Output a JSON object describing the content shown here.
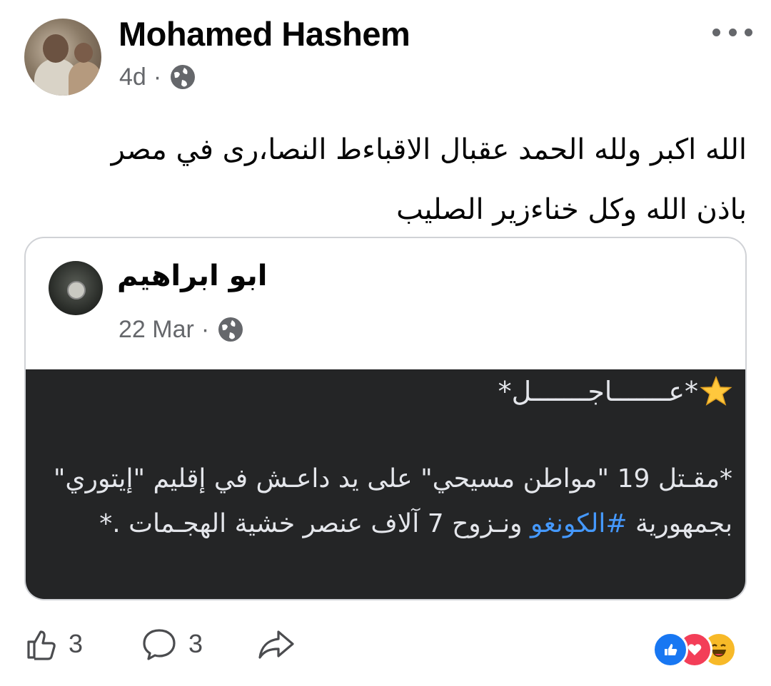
{
  "post": {
    "author": "Mohamed Hashem",
    "time": "4d",
    "separator": "·",
    "text": "الله اكبر ولله الحمد عقبال الاقباءط النصا،رى في مصر باذن الله وكل خناءزير الصليب"
  },
  "shared_post": {
    "author": "ابو ابراهيم",
    "time": "22 Mar",
    "separator": "·",
    "headline": "*عـــــــاجـــــــل*",
    "body_part1": "*مقـتل 19 \"مواطن مسيحي\" على يد داعـش في إقليم \"إيتوري\" بجمهورية",
    "hashtag": "#الكونغو",
    "body_part2": "ونـزوح 7 آلاف عنصر خشية الهجـمات .*"
  },
  "footer": {
    "like_count": "3",
    "comment_count": "3"
  },
  "icons": {
    "privacy": "globe-icon",
    "menu": "more-icon",
    "star": "star-icon",
    "like": "like-icon",
    "comment": "comment-icon",
    "share": "share-icon"
  },
  "colors": {
    "hashtag": "#4599ff",
    "like_reaction": "#1877f2",
    "love_reaction": "#f33e58",
    "haha_reaction": "#f7b928"
  }
}
